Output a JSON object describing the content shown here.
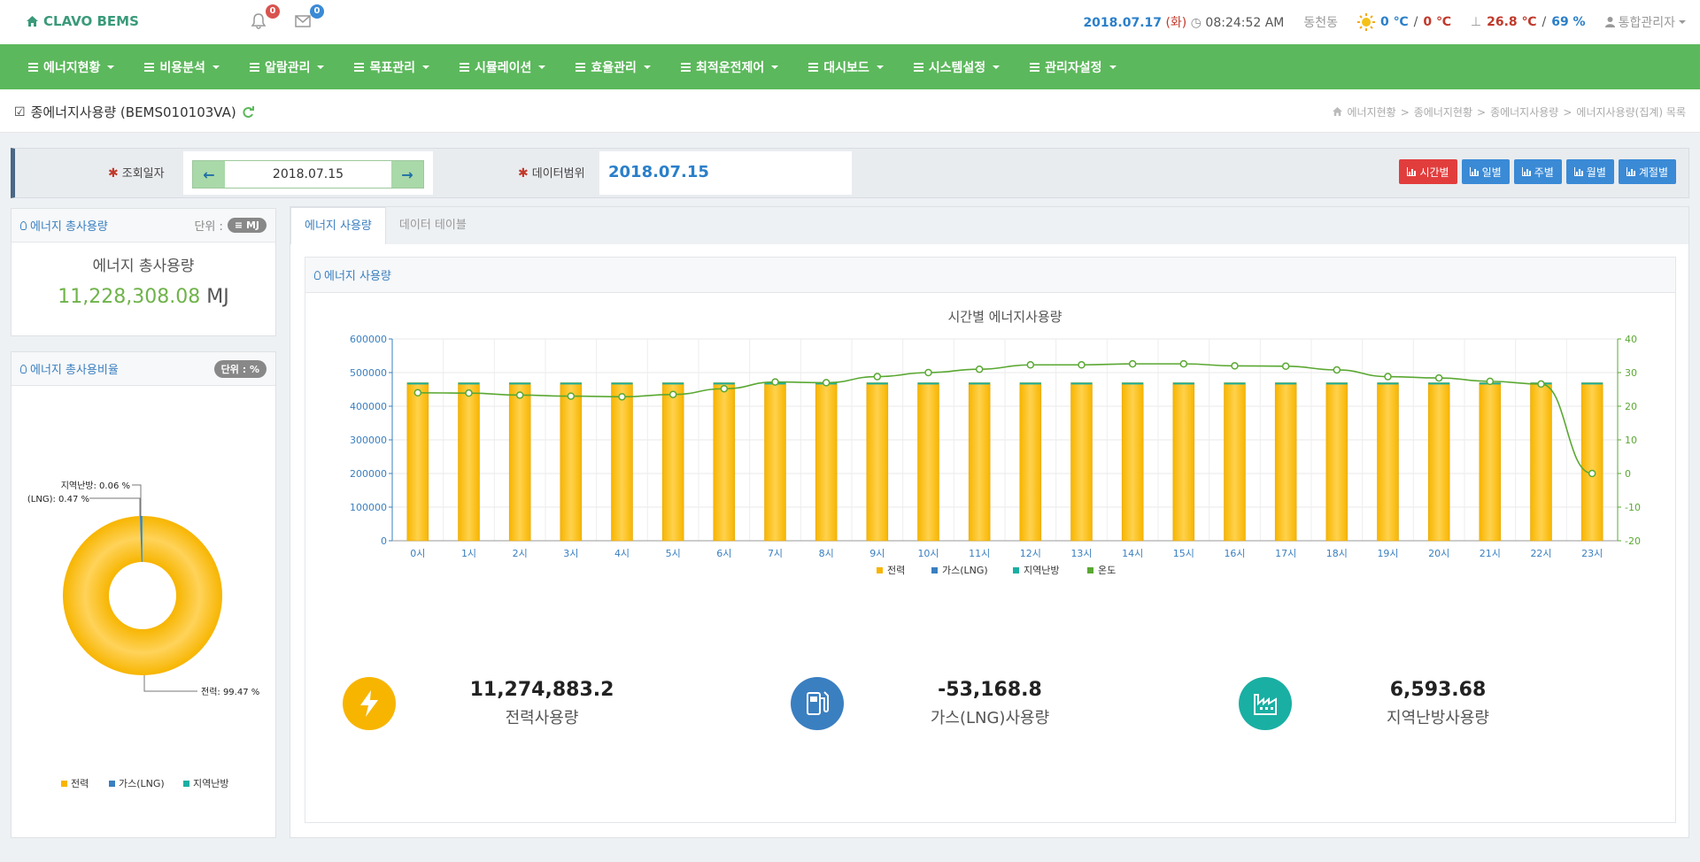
{
  "header": {
    "brand": "CLAVO BEMS",
    "alarm_count": "0",
    "message_count": "0",
    "date": "2018.07.17",
    "weekday": "(화)",
    "time": "08:24:52 AM",
    "building": "동천동",
    "outside_temp_a": "0 ℃",
    "outside_temp_sep": " / ",
    "outside_temp_b": "0 ℃",
    "inside_temp": "26.8 ℃",
    "inside_sep": " / ",
    "inside_humidity": "69 %",
    "user": "통합관리자"
  },
  "nav": [
    "에너지현황",
    "비용분석",
    "알람관리",
    "목표관리",
    "시뮬레이션",
    "효율관리",
    "최적운전제어",
    "대시보드",
    "시스템설정",
    "관리자설정"
  ],
  "page": {
    "title": "종에너지사용량 (BEMS010103VA)",
    "breadcrumb": [
      "에너지현황",
      "종에너지현황",
      "종에너지사용량",
      "에너지사용량(집계) 목록"
    ]
  },
  "search": {
    "date_label": "조회일자",
    "date_value": "2018.07.15",
    "range_label": "데이터범위",
    "range_value": "2018.07.15",
    "period_buttons": [
      "시간별",
      "일별",
      "주별",
      "월별",
      "계절별"
    ]
  },
  "total_panel": {
    "header": "에너지 총사용량",
    "unit_label": "단위 :",
    "unit": "MJ",
    "title": "에너지 총사용량",
    "value": "11,228,308.08",
    "value_unit": "MJ"
  },
  "ratio_panel": {
    "header": "에너지 총사용비율",
    "unit": "단위 : %",
    "labels": [
      "지역난방: 0.06 %",
      "(LNG): 0.47 %",
      "전력: 99.47 %"
    ],
    "legend": [
      "전력",
      "가스(LNG)",
      "지역난방"
    ]
  },
  "tabs": [
    "에너지 사용량",
    "데이터 테이블"
  ],
  "chart_panel": {
    "header": "에너지 사용량",
    "legend": [
      "전력",
      "가스(LNG)",
      "지역난방",
      "온도"
    ]
  },
  "colors": {
    "electric": "#f7b500",
    "gas": "#3a7fc0",
    "district": "#1aafa3",
    "temp": "#5aa832",
    "nav": "#5cb85c"
  },
  "chart_data": {
    "type": "bar",
    "title": "시간별 에너지사용량",
    "categories": [
      "0시",
      "1시",
      "2시",
      "3시",
      "4시",
      "5시",
      "6시",
      "7시",
      "8시",
      "9시",
      "10시",
      "11시",
      "12시",
      "13시",
      "14시",
      "15시",
      "16시",
      "17시",
      "18시",
      "19시",
      "20시",
      "21시",
      "22시",
      "23시"
    ],
    "series": [
      {
        "name": "전력",
        "type": "bar",
        "axis": "left",
        "values": [
          470000,
          470000,
          470000,
          470000,
          470000,
          470000,
          470000,
          470000,
          470000,
          470000,
          470000,
          470000,
          470000,
          470000,
          470000,
          470000,
          470000,
          470000,
          470000,
          470000,
          470000,
          470000,
          470000,
          470000
        ]
      },
      {
        "name": "온도",
        "type": "line",
        "axis": "right",
        "values": [
          24.0,
          23.9,
          23.3,
          23.0,
          22.8,
          23.5,
          25.2,
          27.2,
          27.0,
          28.8,
          30.0,
          31.0,
          32.3,
          32.3,
          32.6,
          32.6,
          32.0,
          31.9,
          30.8,
          28.8,
          28.4,
          27.4,
          26.6,
          0
        ]
      }
    ],
    "yticks_left": [
      "600000",
      "500000",
      "400000",
      "300000",
      "200000",
      "100000",
      "0"
    ],
    "yticks_right": [
      "40",
      "30",
      "20",
      "10",
      "0",
      "-10",
      "-20"
    ],
    "ylim_left": [
      0,
      600000
    ],
    "ylim_right": [
      -20,
      40
    ],
    "legend_position": "bottom"
  },
  "donut_data": {
    "type": "pie",
    "categories": [
      "전력",
      "가스(LNG)",
      "지역난방"
    ],
    "values": [
      99.47,
      0.47,
      0.06
    ]
  },
  "stats": [
    {
      "value": "11,274,883.2",
      "label": "전력사용량",
      "icon": "lightning-icon"
    },
    {
      "value": "-53,168.8",
      "label": "가스(LNG)사용량",
      "icon": "gas-pump-icon"
    },
    {
      "value": "6,593.68",
      "label": "지역난방사용량",
      "icon": "factory-icon"
    }
  ]
}
